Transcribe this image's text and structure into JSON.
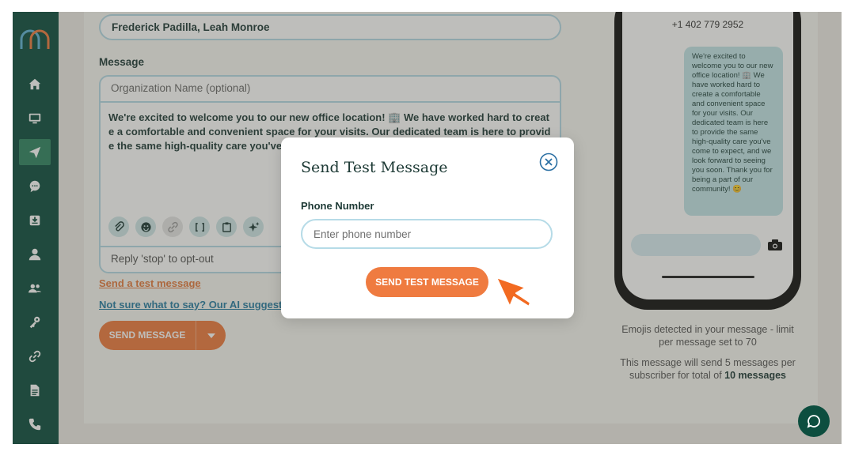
{
  "recipients": {
    "value": "Frederick Padilla, Leah Monroe"
  },
  "composer": {
    "label": "Message",
    "org_placeholder": "Organization Name (optional)",
    "message_text": "We're excited to welcome you to our new office location! 🏢 We have worked hard to create a comfortable and convenient space for your visits. Our dedicated team is here to provide the same high-quality care you've co hank you for being a part of our com",
    "optout": "Reply 'stop' to opt-out"
  },
  "links": {
    "send_test": "Send a test message",
    "ai_suggestion": "Not sure what to say? Our AI suggestio"
  },
  "send_button": {
    "label": "SEND MESSAGE"
  },
  "phone_preview": {
    "number": "+1 402 779 2952",
    "bubble_text": "We're excited to welcome you to our new office location! 🏢 We have worked hard to create a comfortable and convenient space for your visits. Our dedicated team is here to provide the same high-quality care you've come to expect, and we look forward to seeing you soon. Thank you for being a part of our community! 😊"
  },
  "notes": {
    "emoji_limit": "Emojis detected in your message - limit per message set to 70",
    "segments_prefix": "This message will send 5 messages per subscriber for total of",
    "segments_total": "10 messages"
  },
  "modal": {
    "title": "Send Test Message",
    "field_label": "Phone Number",
    "field_placeholder": "Enter phone number",
    "submit_label": "SEND TEST MESSAGE"
  },
  "colors": {
    "brand": "#0d4e3f",
    "accent": "#ef7b40",
    "border": "#b6dbe7",
    "link": "#2a7ea3"
  },
  "icons": {
    "sidebar": [
      "home-icon",
      "monitor-icon",
      "send-icon",
      "chat-icon",
      "inbox-icon",
      "user-icon",
      "users-icon",
      "key-icon",
      "link-icon",
      "document-icon",
      "phone-call-icon"
    ],
    "toolbar": [
      "paperclip-icon",
      "emoji-icon",
      "link-icon",
      "brackets-icon",
      "clipboard-icon",
      "sparkle-icon"
    ]
  }
}
